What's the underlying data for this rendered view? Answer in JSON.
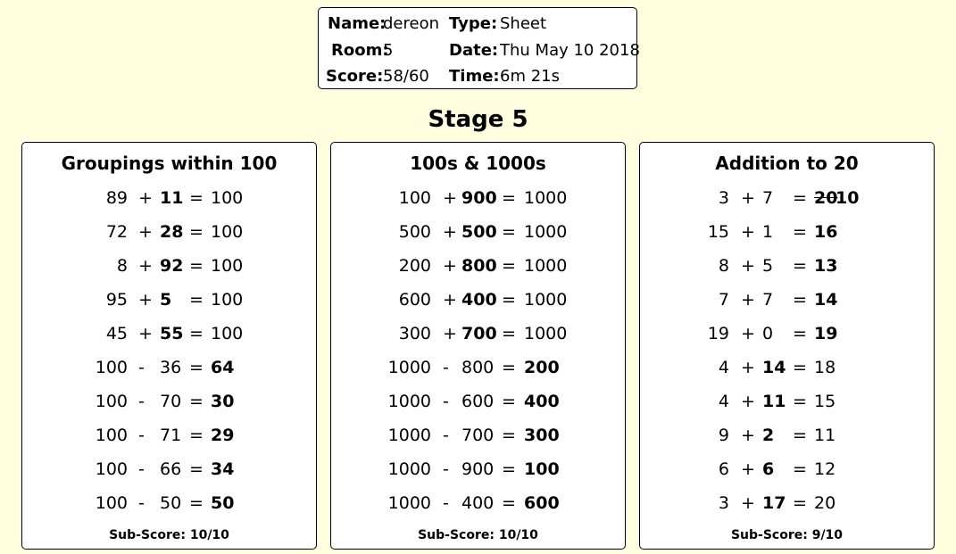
{
  "header": {
    "name_label": "Name:",
    "name_value": "dereon",
    "type_label": "Type:",
    "type_value": "Sheet",
    "room_label": "Room:",
    "room_value": "5",
    "date_label": "Date:",
    "date_value": "Thu May 10 2018",
    "score_label": "Score:",
    "score_value": "58/60",
    "time_label": "Time:",
    "time_value": "6m 21s"
  },
  "stage_title": "Stage 5",
  "panels": [
    {
      "title": "Groupings within 100",
      "subscore": "Sub-Score: 10/10",
      "questions": [
        {
          "a": "89",
          "op": "+",
          "b": "11",
          "eq": "=",
          "c": "100",
          "bold": "b"
        },
        {
          "a": "72",
          "op": "+",
          "b": "28",
          "eq": "=",
          "c": "100",
          "bold": "b"
        },
        {
          "a": "8",
          "op": "+",
          "b": "92",
          "eq": "=",
          "c": "100",
          "bold": "b"
        },
        {
          "a": "95",
          "op": "+",
          "b": "5",
          "eq": "=",
          "c": "100",
          "bold": "b"
        },
        {
          "a": "45",
          "op": "+",
          "b": "55",
          "eq": "=",
          "c": "100",
          "bold": "b"
        },
        {
          "a": "100",
          "op": "-",
          "b": "36",
          "eq": "=",
          "c": "64",
          "bold": "c"
        },
        {
          "a": "100",
          "op": "-",
          "b": "70",
          "eq": "=",
          "c": "30",
          "bold": "c"
        },
        {
          "a": "100",
          "op": "-",
          "b": "71",
          "eq": "=",
          "c": "29",
          "bold": "c"
        },
        {
          "a": "100",
          "op": "-",
          "b": "66",
          "eq": "=",
          "c": "34",
          "bold": "c"
        },
        {
          "a": "100",
          "op": "-",
          "b": "50",
          "eq": "=",
          "c": "50",
          "bold": "c"
        }
      ]
    },
    {
      "title": "100s & 1000s",
      "subscore": "Sub-Score: 10/10",
      "questions": [
        {
          "a": "100",
          "op": "+",
          "b": "900",
          "eq": "=",
          "c": "1000",
          "bold": "b"
        },
        {
          "a": "500",
          "op": "+",
          "b": "500",
          "eq": "=",
          "c": "1000",
          "bold": "b"
        },
        {
          "a": "200",
          "op": "+",
          "b": "800",
          "eq": "=",
          "c": "1000",
          "bold": "b"
        },
        {
          "a": "600",
          "op": "+",
          "b": "400",
          "eq": "=",
          "c": "1000",
          "bold": "b"
        },
        {
          "a": "300",
          "op": "+",
          "b": "700",
          "eq": "=",
          "c": "1000",
          "bold": "b"
        },
        {
          "a": "1000",
          "op": "-",
          "b": "800",
          "eq": "=",
          "c": "200",
          "bold": "c"
        },
        {
          "a": "1000",
          "op": "-",
          "b": "600",
          "eq": "=",
          "c": "400",
          "bold": "c"
        },
        {
          "a": "1000",
          "op": "-",
          "b": "700",
          "eq": "=",
          "c": "300",
          "bold": "c"
        },
        {
          "a": "1000",
          "op": "-",
          "b": "900",
          "eq": "=",
          "c": "100",
          "bold": "c"
        },
        {
          "a": "1000",
          "op": "-",
          "b": "400",
          "eq": "=",
          "c": "600",
          "bold": "c"
        }
      ]
    },
    {
      "title": "Addition to 20",
      "subscore": "Sub-Score: 9/10",
      "questions": [
        {
          "a": "3",
          "op": "+",
          "b": "7",
          "eq": "=",
          "c": "20",
          "correction": "10",
          "bold": "c"
        },
        {
          "a": "15",
          "op": "+",
          "b": "1",
          "eq": "=",
          "c": "16",
          "bold": "c"
        },
        {
          "a": "8",
          "op": "+",
          "b": "5",
          "eq": "=",
          "c": "13",
          "bold": "c"
        },
        {
          "a": "7",
          "op": "+",
          "b": "7",
          "eq": "=",
          "c": "14",
          "bold": "c"
        },
        {
          "a": "19",
          "op": "+",
          "b": "0",
          "eq": "=",
          "c": "19",
          "bold": "c"
        },
        {
          "a": "4",
          "op": "+",
          "b": "14",
          "eq": "=",
          "c": "18",
          "bold": "b"
        },
        {
          "a": "4",
          "op": "+",
          "b": "11",
          "eq": "=",
          "c": "15",
          "bold": "b"
        },
        {
          "a": "9",
          "op": "+",
          "b": "2",
          "eq": "=",
          "c": "11",
          "bold": "b"
        },
        {
          "a": "6",
          "op": "+",
          "b": "6",
          "eq": "=",
          "c": "12",
          "bold": "b"
        },
        {
          "a": "3",
          "op": "+",
          "b": "17",
          "eq": "=",
          "c": "20",
          "bold": "b"
        }
      ]
    }
  ]
}
